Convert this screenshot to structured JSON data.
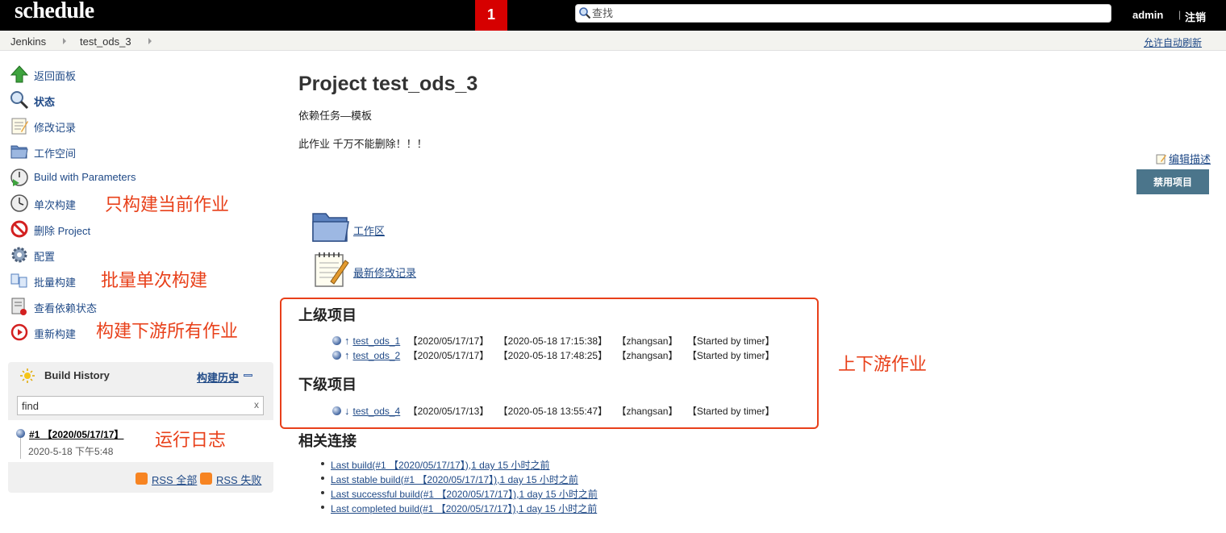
{
  "header": {
    "logo": "schedule",
    "badge": "1",
    "search_placeholder": "查找",
    "user": "admin",
    "separator": "|",
    "logout": "注销"
  },
  "breadcrumb": {
    "items": [
      "Jenkins",
      "test_ods_3"
    ],
    "auto_refresh": "允许自动刷新"
  },
  "sidebar": {
    "tasks": [
      {
        "label": "返回面板",
        "icon": "up-arrow-icon"
      },
      {
        "label": "状态",
        "icon": "magnifier-icon"
      },
      {
        "label": "修改记录",
        "icon": "notepad-icon"
      },
      {
        "label": "工作空间",
        "icon": "folder-icon"
      },
      {
        "label": "Build with Parameters",
        "icon": "clock-play-icon"
      },
      {
        "label": "单次构建",
        "icon": "clock-icon"
      },
      {
        "label": "删除 Project",
        "icon": "no-entry-icon"
      },
      {
        "label": "配置",
        "icon": "gear-icon"
      },
      {
        "label": "批量构建",
        "icon": "batch-icon"
      },
      {
        "label": "查看依赖状态",
        "icon": "dependency-icon"
      },
      {
        "label": "重新构建",
        "icon": "rebuild-icon"
      }
    ],
    "annotations": {
      "single_build": "只构建当前作业",
      "batch_build": "批量单次构建",
      "rebuild": "构建下游所有作业",
      "log": "运行日志"
    }
  },
  "build_history": {
    "title": "Build History",
    "trend_link": "构建历史",
    "filter_value": "find",
    "clear": "x",
    "builds": [
      {
        "name": "#1 【2020/05/17/17】",
        "date": "2020-5-18 下午5:48"
      }
    ],
    "rss_all": "RSS 全部",
    "rss_fail": "RSS 失败"
  },
  "main": {
    "title": "Project test_ods_3",
    "description_line1": "依赖任务—模板",
    "description_line2": "此作业 千万不能删除！！！",
    "edit_description": "编辑描述",
    "disable_button": "禁用项目",
    "workspace_link": "工作区",
    "changes_link": "最新修改记录",
    "upstream_title": "上级项目",
    "downstream_title": "下级项目",
    "box_annotation": "上下游作业",
    "upstream": [
      {
        "arrow": "↑",
        "name": "test_ods_1",
        "f1": "【2020/05/17/17】",
        "f2": "【2020-05-18 17:15:38】",
        "f3": "【zhangsan】",
        "f4": "【Started by timer】"
      },
      {
        "arrow": "↑",
        "name": "test_ods_2",
        "f1": "【2020/05/17/17】",
        "f2": "【2020-05-18 17:48:25】",
        "f3": "【zhangsan】",
        "f4": "【Started by timer】"
      }
    ],
    "downstream": [
      {
        "arrow": "↓",
        "name": "test_ods_4",
        "f1": "【2020/05/17/13】",
        "f2": "【2020-05-18 13:55:47】",
        "f3": "【zhangsan】",
        "f4": "【Started by timer】"
      }
    ],
    "related_title": "相关连接",
    "related": [
      "Last build(#1 【2020/05/17/17】),1 day 15 小时之前",
      "Last stable build(#1 【2020/05/17/17】),1 day 15 小时之前",
      "Last successful build(#1 【2020/05/17/17】),1 day 15 小时之前",
      "Last completed build(#1 【2020/05/17/17】),1 day 15 小时之前"
    ]
  },
  "colors": {
    "link": "#204a87",
    "annotation": "#e8401a",
    "badge": "#d60000",
    "button": "#4b758b"
  }
}
